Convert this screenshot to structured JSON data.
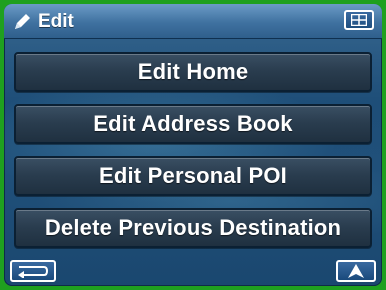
{
  "header": {
    "title": "Edit",
    "title_icon": "pencil-icon",
    "menu_icon": "grid-menu-icon"
  },
  "menu": {
    "items": [
      {
        "label": "Edit Home"
      },
      {
        "label": "Edit Address Book"
      },
      {
        "label": "Edit Personal POI"
      },
      {
        "label": "Delete Previous Destination"
      }
    ]
  },
  "footer": {
    "back_icon": "return-arrow-icon",
    "nav_icon": "navigation-arrow-icon"
  },
  "colors": {
    "border": "#1fa01f",
    "title_bar": "#3f71a0",
    "button_face": "#2a3d4f",
    "text": "#ffffff"
  }
}
